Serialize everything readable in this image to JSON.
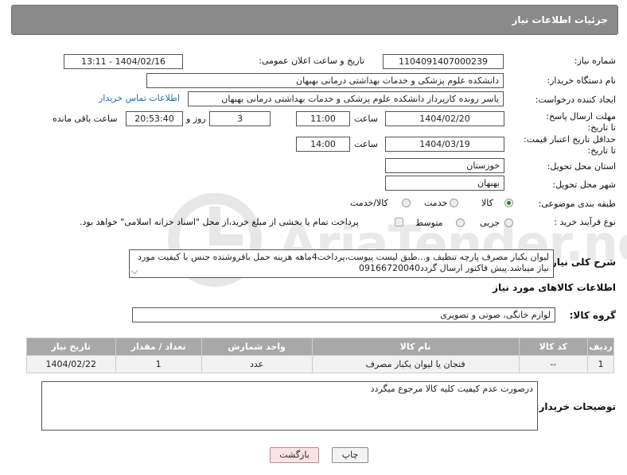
{
  "header": {
    "title": "جزئیات اطلاعات نیاز"
  },
  "fields": {
    "need_number_label": "شماره نیاز:",
    "need_number": "1104091407000239",
    "announce_label": "تاریخ و ساعت اعلان عمومی:",
    "announce_value": "1404/02/16 - 13:11",
    "buyer_label": "نام دستگاه خریدار:",
    "buyer": "دانشکده علوم پزشکی و خدمات بهداشتی  درمانی بهبهان",
    "creator_label": "ایجاد کننده درخواست:",
    "creator": "یاسر رونده کارپرداز دانشکده علوم پزشکی و خدمات بهداشتی  درمانی بهبهان",
    "contact_link": "اطلاعات تماس خریدار",
    "deadline_label": "مهلت ارسال پاسخ: تا تاریخ:",
    "deadline_date": "1404/02/20",
    "time_label": "ساعت",
    "deadline_time": "11:00",
    "days_value": "3",
    "days_label": "روز و",
    "remaining_time": "20:53:40",
    "remaining_label": "ساعت باقی مانده",
    "min_price_label": "حداقل تاریخ اعتبار قیمت: تا تاریخ:",
    "min_price_date": "1404/03/19",
    "min_price_time_label": "ساعت",
    "min_price_time": "14:00",
    "province_label": "استان محل تحویل:",
    "province": "خوزستان",
    "city_label": "شهر محل تحویل:",
    "city": "بهبهان",
    "category_label": "طبقه بندی موضوعی:",
    "category_options": [
      "کالا",
      "خدمت",
      "کالا/خدمت"
    ],
    "process_label": "نوع فرآیند خرید :",
    "process_options": [
      "جزیی",
      "متوسط"
    ],
    "payment_note": "پرداخت تمام یا بخشی از مبلغ خرید،از محل \"اسناد خزانه اسلامی\" خواهد بود."
  },
  "description": {
    "label": "شرح کلی نیاز:",
    "text": "لیوان یکبار مصرف پارچه تنظیف و...طبق لیست پیوست،پرداخت4ماهه هزینه حمل بافروشنده جنس با کیفیت مورد نیاز میباشد.پیش فاکتور ارسال گردد09166720040"
  },
  "goods_section": {
    "title": "اطلاعات کالاهای مورد نیاز",
    "group_label": "گروه کالا:",
    "group_value": "لوازم خانگی، صوتی و تصویری"
  },
  "table": {
    "headers": [
      "ردیف",
      "کد کالا",
      "نام کالا",
      "واحد شمارش",
      "تعداد / مقدار",
      "تاریخ نیاز"
    ],
    "rows": [
      [
        "1",
        "--",
        "فنجان یا لیوان یکبار مصرف",
        "عدد",
        "1",
        "1404/02/22"
      ]
    ]
  },
  "buyer_notes": {
    "label": "توضیحات خریدار:",
    "text": "درصورت عدم کیفیت کلیه کالا مرجوع میگردد"
  },
  "buttons": {
    "print": "چاپ",
    "back": "بازگشت"
  },
  "watermark": {
    "text": "AriaTender.neT"
  }
}
